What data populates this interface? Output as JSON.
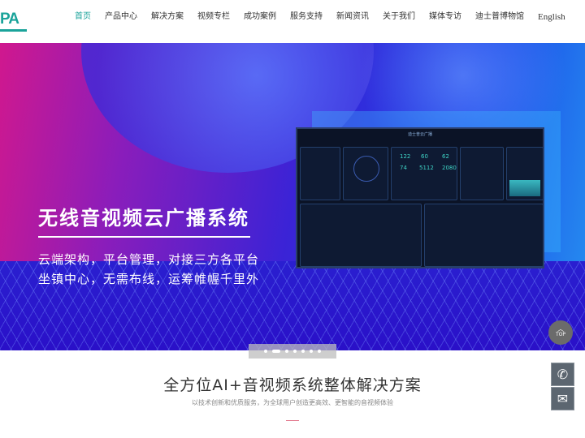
{
  "nav": {
    "logo": "PA",
    "items": [
      "首页",
      "产品中心",
      "解决方案",
      "视频专栏",
      "成功案例",
      "服务支持",
      "新闻资讯",
      "关于我们",
      "媒体专访",
      "迪士普博物馆",
      "English"
    ],
    "active_index": 0,
    "accent": "#1aa39a"
  },
  "banner": {
    "headline": "无线音视频云广播系统",
    "line1": "云端架构，平台管理，对接三方各平台",
    "line2": "坐镇中心，无需布线，运筹帷幄千里外",
    "dashboard": {
      "title": "迪士普云广播",
      "stats": [
        "122",
        "60",
        "62",
        "74",
        "5112",
        "2080"
      ]
    },
    "slides": 7,
    "active_slide": 1
  },
  "top_label": "TOP",
  "floating": {
    "phone_icon": "phone-icon",
    "mail_icon": "mail-icon"
  },
  "section": {
    "title": "全方位AI+音视频系统整体解决方案",
    "subtitle": "以技术创新和优质服务，为全球用户创造更高效、更智能的音视频体验"
  }
}
